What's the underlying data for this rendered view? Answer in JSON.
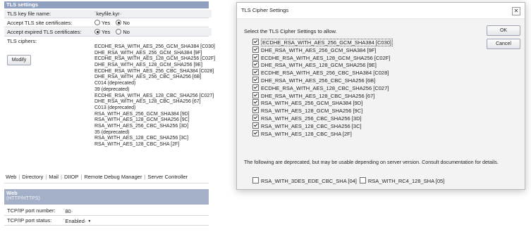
{
  "tls_settings": {
    "title": "TLS settings",
    "key_file_label": "TLS key file name:",
    "key_file_value": "keyfile.kyr",
    "accept_site_label": "Accept TLS site certificates:",
    "accept_site_yes": "Yes",
    "accept_site_no": "No",
    "accept_expired_label": "Accept expired TLS certificates:",
    "accept_expired_yes": "Yes",
    "accept_expired_no": "No",
    "ciphers_label": "TLS ciphers:",
    "modify_label": "Modify",
    "ciphers": [
      "ECDHE_RSA_WITH_AES_256_GCM_SHA384 [C030]",
      "DHE_RSA_WITH_AES_256_GCM_SHA384 [9F]",
      "ECDHE_RSA_WITH_AES_128_GCM_SHA256 [C02F]",
      "DHE_RSA_WITH_AES_128_GCM_SHA256 [9E]",
      "ECDHE_RSA_WITH_AES_256_CBC_SHA384 [C028]",
      "DHE_RSA_WITH_AES_256_CBC_SHA256 [6B]",
      "C014 (deprecated)",
      "39 (deprecated)",
      "ECDHE_RSA_WITH_AES_128_CBC_SHA256 [C027]",
      "DHE_RSA_WITH_AES_128_CBC_SHA256 [67]",
      "C013 (deprecated)",
      "RSA_WITH_AES_256_GCM_SHA384 [9D]",
      "RSA_WITH_AES_128_GCM_SHA256 [9C]",
      "RSA_WITH_AES_256_CBC_SHA256 [3D]",
      "35 (deprecated)",
      "RSA_WITH_AES_128_CBC_SHA256 [3C]",
      "RSA_WITH_AES_128_CBC_SHA [2F]"
    ]
  },
  "tabs": [
    "Web",
    "Directory",
    "Mail",
    "DIIOP",
    "Remote Debug Manager",
    "Server Controller"
  ],
  "web": {
    "title": "Web",
    "subtitle": "(HTTP/HTTPS)",
    "port_label": "TCP/IP port number:",
    "port_value": "80",
    "status_label": "TCP/IP port status:",
    "status_value": "Enabled"
  },
  "dialog": {
    "title": "TLS Cipher Settings",
    "close_glyph": "✕",
    "instruction": "Select the TLS Cipher Settings to allow.",
    "ok_label": "OK",
    "cancel_label": "Cancel",
    "ciphers": [
      {
        "label": "ECDHE_RSA_WITH_AES_256_GCM_SHA384 [C030]",
        "checked": true
      },
      {
        "label": "DHE_RSA_WITH_AES_256_GCM_SHA384 [9F]",
        "checked": true
      },
      {
        "label": "ECDHE_RSA_WITH_AES_128_GCM_SHA256 [C02F]",
        "checked": true
      },
      {
        "label": "DHE_RSA_WITH_AES_128_GCM_SHA256 [9E]",
        "checked": true
      },
      {
        "label": "ECDHE_RSA_WITH_AES_256_CBC_SHA384 [C028]",
        "checked": true
      },
      {
        "label": "DHE_RSA_WITH_AES_256_CBC_SHA256 [6B]",
        "checked": true
      },
      {
        "label": "ECDHE_RSA_WITH_AES_128_CBC_SHA256 [C027]",
        "checked": true
      },
      {
        "label": "DHE_RSA_WITH_AES_128_CBC_SHA256 [67]",
        "checked": true
      },
      {
        "label": "RSA_WITH_AES_256_GCM_SHA384 [9D]",
        "checked": true
      },
      {
        "label": "RSA_WITH_AES_128_GCM_SHA256 [9C]",
        "checked": true
      },
      {
        "label": "RSA_WITH_AES_256_CBC_SHA256 [3D]",
        "checked": true
      },
      {
        "label": "RSA_WITH_AES_128_CBC_SHA256 [3C]",
        "checked": true
      },
      {
        "label": "RSA_WITH_AES_128_CBC_SHA [2F]",
        "checked": true
      }
    ],
    "deprecated_note": "The following are deprecated, but may be usable depending on server version. Consult documentation for details.",
    "deprecated": [
      {
        "label": "RSA_WITH_3DES_EDE_CBC_SHA [04]",
        "checked": false
      },
      {
        "label": "RSA_WITH_RC4_128_SHA [05]",
        "checked": false
      }
    ]
  }
}
